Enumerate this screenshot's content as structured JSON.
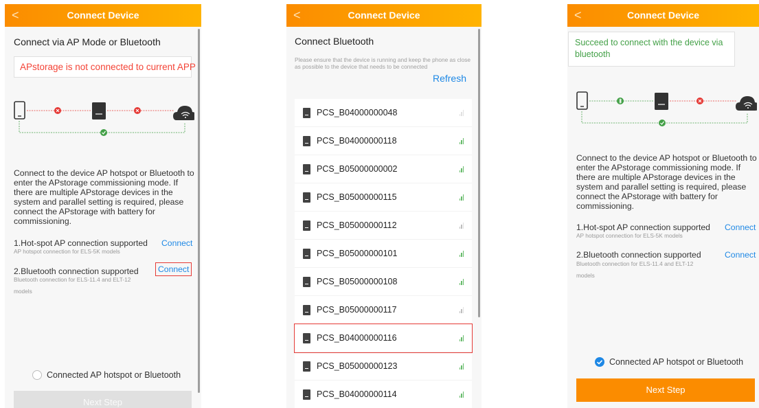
{
  "screen1": {
    "back": "<",
    "title": "Connect Device",
    "heading": "Connect via AP Mode or Bluetooth",
    "warning": "APstorage is not connected to current APP",
    "description": "Connect to the device AP hotspot or Bluetooth to enter the APstorage commissioning mode. If there are multiple APstorage devices in the system and parallel setting is required, please connect the APstorage with battery for commissioning.",
    "option1": {
      "title": "1.Hot-spot AP connection supported",
      "subtitle": "AP hotspot connection for ELS-5K models",
      "action": "Connect"
    },
    "option2": {
      "title": "2.Bluetooth connection supported",
      "subtitle": "Bluetooth connection for ELS-11.4 and ELT-12 models",
      "action": "Connect"
    },
    "confirm_label": "Connected AP hotspot or Bluetooth",
    "confirm_checked": false,
    "next_label": "Next Step"
  },
  "screen2": {
    "back": "<",
    "title": "Connect Device",
    "heading": "Connect Bluetooth",
    "note": "Please ensure that the device is running and keep the phone as close as possible to the device that needs to be connected",
    "refresh": "Refresh",
    "devices": [
      {
        "name": "PCS_B04000000048",
        "signal": "weak"
      },
      {
        "name": "PCS_B04000000118",
        "signal": "strong"
      },
      {
        "name": "PCS_B05000000002",
        "signal": "strong"
      },
      {
        "name": "PCS_B05000000115",
        "signal": "strong"
      },
      {
        "name": "PCS_B05000000112",
        "signal": "medium"
      },
      {
        "name": "PCS_B05000000101",
        "signal": "strong"
      },
      {
        "name": "PCS_B05000000108",
        "signal": "strong"
      },
      {
        "name": "PCS_B05000000117",
        "signal": "medium"
      },
      {
        "name": "PCS_B04000000116",
        "signal": "strong",
        "highlighted": true
      },
      {
        "name": "PCS_B05000000123",
        "signal": "strong"
      },
      {
        "name": "PCS_B04000000114",
        "signal": "strong"
      }
    ]
  },
  "screen3": {
    "back": "<",
    "title": "Connect Device",
    "success": "Succeed to connect with the device via bluetooth",
    "description": "Connect to the device AP hotspot or Bluetooth to enter the APstorage commissioning mode. If there are multiple APstorage devices in the system and parallel setting is required, please connect the APstorage with battery for commissioning.",
    "option1": {
      "title": "1.Hot-spot AP connection supported",
      "subtitle": "AP hotspot connection for ELS-5K models",
      "action": "Connect"
    },
    "option2": {
      "title": "2.Bluetooth connection supported",
      "subtitle": "Bluetooth connection for ELS-11.4 and ELT-12 models",
      "action": "Connect"
    },
    "confirm_label": "Connected AP hotspot or Bluetooth",
    "confirm_checked": true,
    "next_label": "Next Step"
  },
  "colors": {
    "brand_orange": "#fb8c00",
    "link_blue": "#1e88e5",
    "error_red": "#f44336",
    "success_green": "#43a047"
  },
  "icons": [
    "phone-icon",
    "inverter-icon",
    "cloud-wifi-icon",
    "error-x-icon",
    "success-check-icon",
    "bluetooth-icon",
    "signal-icon",
    "back-chevron-icon"
  ]
}
